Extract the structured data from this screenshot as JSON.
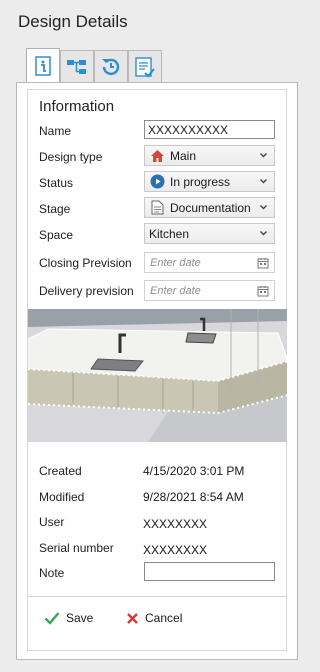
{
  "window": {
    "title": "Design Details"
  },
  "tabs": [
    {
      "icon": "info-icon",
      "active": true
    },
    {
      "icon": "hierarchy-icon",
      "active": false
    },
    {
      "icon": "history-icon",
      "active": false
    },
    {
      "icon": "checklist-icon",
      "active": false
    }
  ],
  "info": {
    "heading": "Information",
    "name_label": "Name",
    "name_value": "XXXXXXXXXX",
    "design_type_label": "Design type",
    "design_type_value": "Main",
    "design_type_icon": "house-icon",
    "status_label": "Status",
    "status_value": "In progress",
    "status_icon": "play-circle-icon",
    "stage_label": "Stage",
    "stage_value": "Documentation",
    "stage_icon": "document-icon",
    "space_label": "Space",
    "space_value": "Kitchen",
    "closing_label": "Closing Prevision",
    "closing_placeholder": "Enter date",
    "delivery_label": "Delivery prevision",
    "delivery_placeholder": "Enter date"
  },
  "meta": {
    "created_label": "Created",
    "created_value": "4/15/2020 3:01 PM",
    "modified_label": "Modified",
    "modified_value": "9/28/2021 8:54 AM",
    "user_label": "User",
    "user_value": "XXXXXXXX",
    "serial_label": "Serial number",
    "serial_value": "XXXXXXXX",
    "note_label": "Note",
    "note_value": ""
  },
  "actions": {
    "save_label": "Save",
    "cancel_label": "Cancel"
  },
  "colors": {
    "accent": "#2b8fd6",
    "save_check": "#3aa655",
    "cancel_x": "#d9363e"
  }
}
